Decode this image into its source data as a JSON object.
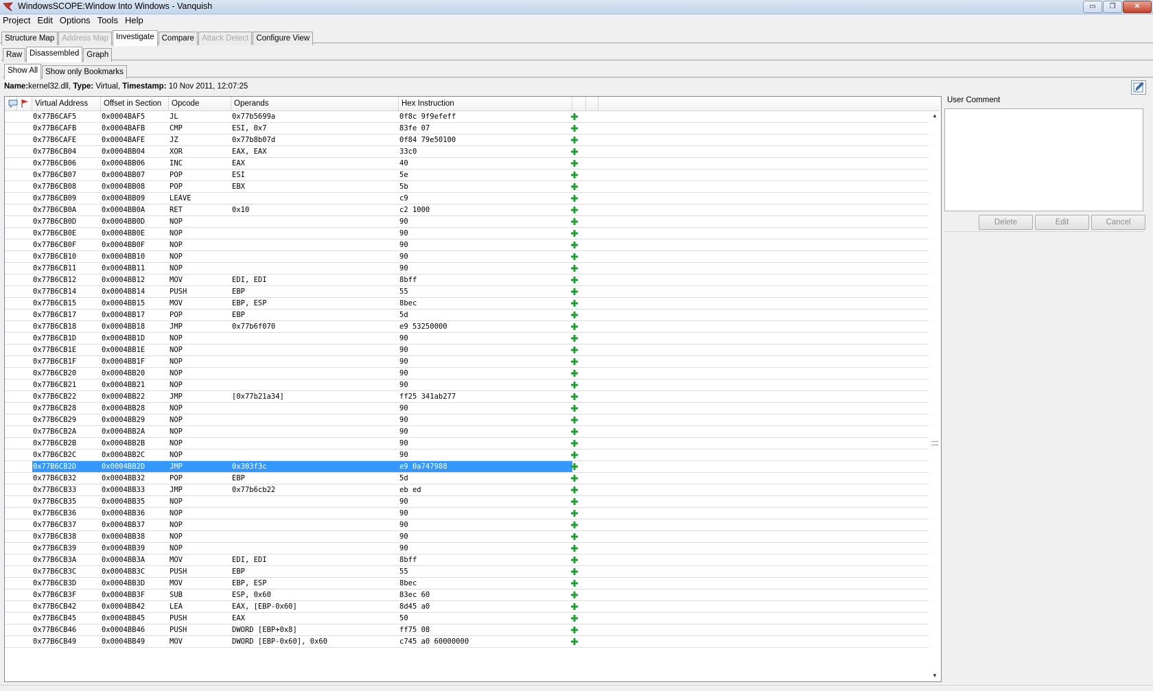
{
  "window": {
    "title": "WindowsSCOPE:Window Into Windows - Vanquish",
    "controls": {
      "minimize": "▭",
      "restore": "❐",
      "close": "✕"
    }
  },
  "menu": [
    "Project",
    "Edit",
    "Options",
    "Tools",
    "Help"
  ],
  "main_tabs": [
    {
      "label": "Structure Map",
      "state": "normal"
    },
    {
      "label": "Address Map",
      "state": "disabled"
    },
    {
      "label": "Investigate",
      "state": "active"
    },
    {
      "label": "Compare",
      "state": "normal"
    },
    {
      "label": "Attack Detect",
      "state": "disabled"
    },
    {
      "label": "Configure View",
      "state": "normal"
    }
  ],
  "view_tabs": [
    {
      "label": "Raw",
      "state": "normal"
    },
    {
      "label": "Disassembled",
      "state": "active"
    },
    {
      "label": "Graph",
      "state": "normal"
    }
  ],
  "filter_tabs": [
    {
      "label": "Show All",
      "state": "active"
    },
    {
      "label": "Show only Bookmarks",
      "state": "normal"
    }
  ],
  "info": {
    "name_label": "Name:",
    "name_value": "kernel32.dll,",
    "type_label": "Type:",
    "type_value": "Virtual,",
    "timestamp_label": "Timestamp:",
    "timestamp_value": "10 Nov 2011, 12:07:25"
  },
  "table": {
    "columns": [
      "Virtual Address",
      "Offset in Section",
      "Opcode",
      "Operands",
      "Hex Instruction"
    ],
    "selected_index": 30,
    "accent_color": "#3399ff",
    "add_icon_color": "#1e9e2e",
    "rows": [
      [
        "0x77B6CAF5",
        "0x0004BAF5",
        "JL",
        "0x77b5699a",
        "0f8c 9f9efeff"
      ],
      [
        "0x77B6CAFB",
        "0x0004BAFB",
        "CMP",
        "ESI, 0x7",
        "83fe 07"
      ],
      [
        "0x77B6CAFE",
        "0x0004BAFE",
        "JZ",
        "0x77b8b07d",
        "0f84 79e50100"
      ],
      [
        "0x77B6CB04",
        "0x0004BB04",
        "XOR",
        "EAX, EAX",
        "33c0"
      ],
      [
        "0x77B6CB06",
        "0x0004BB06",
        "INC",
        "EAX",
        "40"
      ],
      [
        "0x77B6CB07",
        "0x0004BB07",
        "POP",
        "ESI",
        "5e"
      ],
      [
        "0x77B6CB08",
        "0x0004BB08",
        "POP",
        "EBX",
        "5b"
      ],
      [
        "0x77B6CB09",
        "0x0004BB09",
        "LEAVE",
        "",
        "c9"
      ],
      [
        "0x77B6CB0A",
        "0x0004BB0A",
        "RET",
        "0x10",
        "c2 1000"
      ],
      [
        "0x77B6CB0D",
        "0x0004BB0D",
        "NOP",
        "",
        "90"
      ],
      [
        "0x77B6CB0E",
        "0x0004BB0E",
        "NOP",
        "",
        "90"
      ],
      [
        "0x77B6CB0F",
        "0x0004BB0F",
        "NOP",
        "",
        "90"
      ],
      [
        "0x77B6CB10",
        "0x0004BB10",
        "NOP",
        "",
        "90"
      ],
      [
        "0x77B6CB11",
        "0x0004BB11",
        "NOP",
        "",
        "90"
      ],
      [
        "0x77B6CB12",
        "0x0004BB12",
        "MOV",
        "EDI, EDI",
        "8bff"
      ],
      [
        "0x77B6CB14",
        "0x0004BB14",
        "PUSH",
        "EBP",
        "55"
      ],
      [
        "0x77B6CB15",
        "0x0004BB15",
        "MOV",
        "EBP, ESP",
        "8bec"
      ],
      [
        "0x77B6CB17",
        "0x0004BB17",
        "POP",
        "EBP",
        "5d"
      ],
      [
        "0x77B6CB18",
        "0x0004BB18",
        "JMP",
        "0x77b6f070",
        "e9 53250000"
      ],
      [
        "0x77B6CB1D",
        "0x0004BB1D",
        "NOP",
        "",
        "90"
      ],
      [
        "0x77B6CB1E",
        "0x0004BB1E",
        "NOP",
        "",
        "90"
      ],
      [
        "0x77B6CB1F",
        "0x0004BB1F",
        "NOP",
        "",
        "90"
      ],
      [
        "0x77B6CB20",
        "0x0004BB20",
        "NOP",
        "",
        "90"
      ],
      [
        "0x77B6CB21",
        "0x0004BB21",
        "NOP",
        "",
        "90"
      ],
      [
        "0x77B6CB22",
        "0x0004BB22",
        "JMP",
        "[0x77b21a34]",
        "ff25 341ab277"
      ],
      [
        "0x77B6CB28",
        "0x0004BB28",
        "NOP",
        "",
        "90"
      ],
      [
        "0x77B6CB29",
        "0x0004BB29",
        "NOP",
        "",
        "90"
      ],
      [
        "0x77B6CB2A",
        "0x0004BB2A",
        "NOP",
        "",
        "90"
      ],
      [
        "0x77B6CB2B",
        "0x0004BB2B",
        "NOP",
        "",
        "90"
      ],
      [
        "0x77B6CB2C",
        "0x0004BB2C",
        "NOP",
        "",
        "90"
      ],
      [
        "0x77B6CB2D",
        "0x0004BB2D",
        "JMP",
        "0x303f3c",
        "e9 0a747988"
      ],
      [
        "0x77B6CB32",
        "0x0004BB32",
        "POP",
        "EBP",
        "5d"
      ],
      [
        "0x77B6CB33",
        "0x0004BB33",
        "JMP",
        "0x77b6cb22",
        "eb ed"
      ],
      [
        "0x77B6CB35",
        "0x0004BB35",
        "NOP",
        "",
        "90"
      ],
      [
        "0x77B6CB36",
        "0x0004BB36",
        "NOP",
        "",
        "90"
      ],
      [
        "0x77B6CB37",
        "0x0004BB37",
        "NOP",
        "",
        "90"
      ],
      [
        "0x77B6CB38",
        "0x0004BB38",
        "NOP",
        "",
        "90"
      ],
      [
        "0x77B6CB39",
        "0x0004BB39",
        "NOP",
        "",
        "90"
      ],
      [
        "0x77B6CB3A",
        "0x0004BB3A",
        "MOV",
        "EDI, EDI",
        "8bff"
      ],
      [
        "0x77B6CB3C",
        "0x0004BB3C",
        "PUSH",
        "EBP",
        "55"
      ],
      [
        "0x77B6CB3D",
        "0x0004BB3D",
        "MOV",
        "EBP, ESP",
        "8bec"
      ],
      [
        "0x77B6CB3F",
        "0x0004BB3F",
        "SUB",
        "ESP, 0x60",
        "83ec 60"
      ],
      [
        "0x77B6CB42",
        "0x0004BB42",
        "LEA",
        "EAX, [EBP-0x60]",
        "8d45 a0"
      ],
      [
        "0x77B6CB45",
        "0x0004BB45",
        "PUSH",
        "EAX",
        "50"
      ],
      [
        "0x77B6CB46",
        "0x0004BB46",
        "PUSH",
        "DWORD [EBP+0x8]",
        "ff75 08"
      ],
      [
        "0x77B6CB49",
        "0x0004BB49",
        "MOV",
        "DWORD [EBP-0x60], 0x60",
        "c745 a0 60000000"
      ]
    ]
  },
  "comment_panel": {
    "label": "User Comment",
    "buttons": {
      "delete": "Delete",
      "edit": "Edit",
      "cancel": "Cancel"
    }
  }
}
